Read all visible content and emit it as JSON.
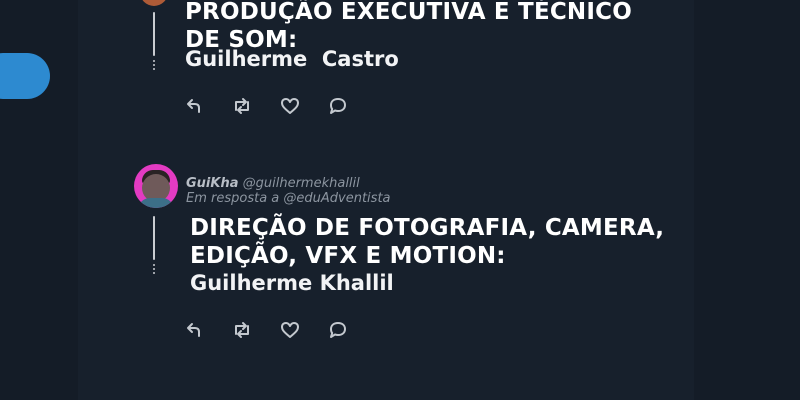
{
  "side_button_color": "#2d8ad0",
  "tweets": [
    {
      "headline_line1": "PRODUÇÃO EXECUTIVA E TÉCNICO",
      "headline_line2": "DE SOM:",
      "person": "Guilherme  Castro",
      "icons": [
        "reply-icon",
        "retweet-icon",
        "like-icon",
        "comment-icon"
      ]
    },
    {
      "display_name": "GuiKha",
      "handle": "@guilhermekhallil",
      "reply_to": "Em resposta a @eduAdventista",
      "headline_line1": "DIREÇÃO DE FOTOGRAFIA, CAMERA,",
      "headline_line2": "EDIÇÃO, VFX E MOTION:",
      "person": "Guilherme Khallil",
      "icons": [
        "reply-icon",
        "retweet-icon",
        "like-icon",
        "comment-icon"
      ]
    }
  ]
}
